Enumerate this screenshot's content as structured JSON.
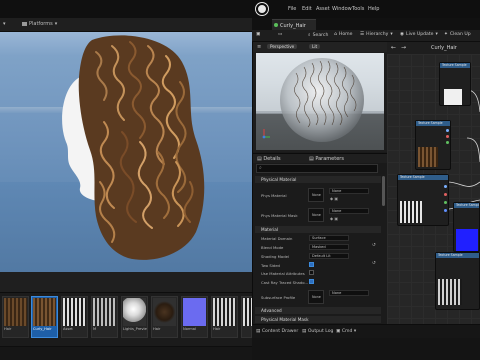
{
  "main_editor": {
    "toolbar": {
      "platforms_label": "Platforms"
    },
    "content_browser": {
      "assets": [
        {
          "label": "Hair"
        },
        {
          "label": "Curly_Hair"
        },
        {
          "label": "Asset"
        },
        {
          "label": "M"
        },
        {
          "label": "Lights_Preview"
        },
        {
          "label": "Hair"
        },
        {
          "label": "Normal"
        },
        {
          "label": "Hair"
        }
      ]
    }
  },
  "material_editor": {
    "menu": [
      "File",
      "Edit",
      "Asset",
      "Window",
      "Tools",
      "Help"
    ],
    "tab_title": "Curly_Hair",
    "toolbar": {
      "save": "Save",
      "search": "Search",
      "home": "Home",
      "hierarchy": "Hierarchy",
      "live_update": "Live Update",
      "clean_up": "Clean Up"
    },
    "preview": {
      "perspective": "Perspective",
      "lit": "Lit"
    },
    "details": {
      "tab_details": "Details",
      "tab_parameters": "Parameters",
      "sections": {
        "physical_material": "Physical Material",
        "material": "Material",
        "advanced": "Advanced",
        "physical_material_mask": "Physical Material Mask"
      },
      "properties": {
        "phys_material": {
          "label": "Phys Material",
          "value": "None"
        },
        "phys_material_mask": {
          "label": "Phys Material Mask",
          "value": "None"
        },
        "material_domain": {
          "label": "Material Domain",
          "value": "Surface"
        },
        "blend_mode": {
          "label": "Blend Mode",
          "value": "Masked"
        },
        "shading_model": {
          "label": "Shading Model",
          "value": "Default Lit"
        },
        "two_sided": {
          "label": "Two Sided"
        },
        "use_material_attributes": {
          "label": "Use Material Attributes"
        },
        "cast_ray_traced_shadows": {
          "label": "Cast Ray Traced Shado..."
        },
        "subsurface_profile": {
          "label": "Subsurface Profile",
          "value": "None"
        }
      }
    },
    "graph": {
      "breadcrumb": "Curly_Hair",
      "nodes": [
        {
          "title": "Texture Sample"
        },
        {
          "title": "Texture Sample"
        },
        {
          "title": "Texture Sample"
        },
        {
          "title": "Texture Sample"
        },
        {
          "title": "Texture Sample"
        }
      ]
    },
    "status_bar": {
      "content_drawer": "Content Drawer",
      "output_log": "Output Log",
      "cmd": "Cmd"
    }
  },
  "colors": {
    "accent_blue": "#1e5fa8",
    "node_header": "#2f5d8a",
    "hair_brown": "#5a3a20"
  }
}
